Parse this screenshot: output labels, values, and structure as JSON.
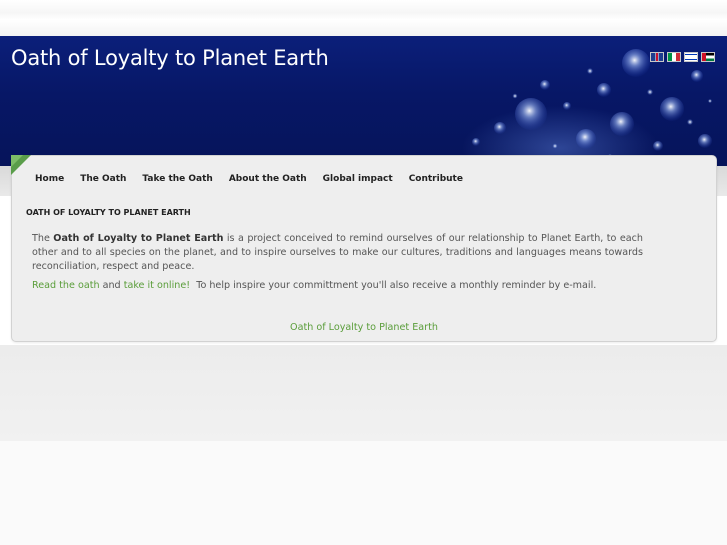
{
  "header": {
    "title": "Oath of Loyalty to Planet Earth",
    "flags": [
      {
        "icon": "flag-uk-icon"
      },
      {
        "icon": "flag-italy-icon"
      },
      {
        "icon": "flag-israel-icon"
      },
      {
        "icon": "flag-palestine-icon"
      }
    ]
  },
  "nav": {
    "items": [
      "Home",
      "The Oath",
      "Take the Oath",
      "About the Oath",
      "Global impact",
      "Contribute"
    ]
  },
  "content": {
    "section_title": "Oath of Loyalty to Planet Earth",
    "intro_prefix": "The ",
    "intro_bold": "Oath of Loyalty to Planet Earth",
    "intro_rest": " is a project conceived to remind ourselves of our relationship to Planet Earth, to each other and to all species on the planet, and to inspire ourselves to make our cultures, traditions and languages means towards reconciliation, respect and peace.",
    "link_read": "Read the oath",
    "and_text": " and ",
    "link_take": "take it online!",
    "reminder_text": "  To help inspire your committment you'll also receive a monthly reminder by e-mail.",
    "footer_link": "Oath of Loyalty to Planet Earth"
  },
  "colors": {
    "header_bg": "#071766",
    "link": "#5a9d3a",
    "accent_corner": "#5a9d4a"
  }
}
